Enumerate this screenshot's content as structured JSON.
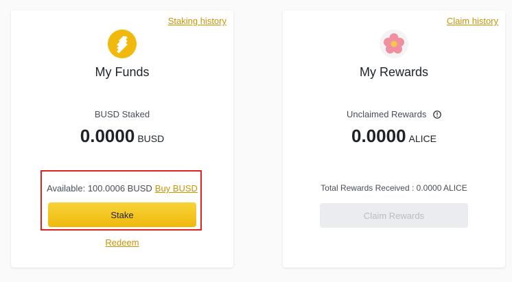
{
  "funds_card": {
    "history_link": "Staking history",
    "icon": "busd-coin-icon",
    "title": "My Funds",
    "staked_label": "BUSD Staked",
    "staked_amount": "0.0000",
    "staked_unit": "BUSD",
    "available_text": "Available: 100.0006 BUSD",
    "buy_link": "Buy BUSD",
    "stake_button": "Stake",
    "redeem_link": "Redeem"
  },
  "rewards_card": {
    "history_link": "Claim history",
    "icon": "alice-token-flower-icon",
    "title": "My Rewards",
    "unclaimed_label": "Unclaimed Rewards",
    "info_icon": "info-icon",
    "unclaimed_amount": "0.0000",
    "unclaimed_unit": "ALICE",
    "total_received": "Total Rewards Received : 0.0000 ALICE",
    "claim_button": "Claim Rewards"
  },
  "colors": {
    "accent": "#c99400",
    "button_yellow": "#f0b90b",
    "highlight_red": "#e02020",
    "disabled_bg": "#eaecef",
    "disabled_text": "#b7bdc6"
  }
}
